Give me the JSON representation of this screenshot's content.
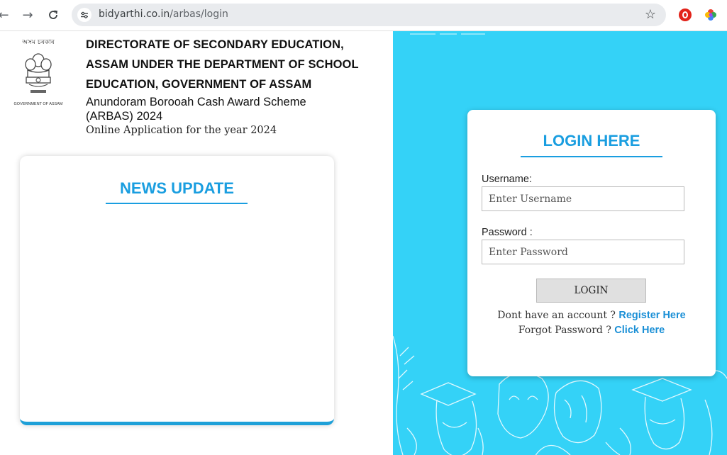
{
  "browser": {
    "url_host": "bidyarthi.co.in",
    "url_path": "/arbas/login",
    "icons": [
      "back-arrow-icon",
      "forward-arrow-icon",
      "reload-icon",
      "site-info-icon",
      "bookmark-star-icon",
      "opera-icon",
      "extension-icon"
    ]
  },
  "header": {
    "emblem_top": "অসম চৰকাৰ",
    "emblem_bottom": "GOVERNMENT OF ASSAM",
    "title_lines": [
      "DIRECTORATE OF SECONDARY EDUCATION,",
      "ASSAM UNDER THE DEPARTMENT OF SCHOOL",
      "EDUCATION, GOVERNMENT OF ASSAM"
    ],
    "scheme_lines": [
      "Anundoram Borooah Cash Award Scheme",
      "(ARBAS) 2024"
    ],
    "online": "Online Application for the year 2024"
  },
  "news": {
    "title": "NEWS UPDATE"
  },
  "login": {
    "title": "LOGIN HERE",
    "username_label": "Username:",
    "username_placeholder": "Enter Username",
    "password_label": "Password :",
    "password_placeholder": "Enter Password",
    "button": "LOGIN",
    "register_prompt": "Dont have an account ?",
    "register_link": "Register Here",
    "forgot_prompt": "Forgot Password ?",
    "forgot_link": "Click Here"
  },
  "colors": {
    "accent": "#1a9ee0",
    "right_bg": "#34d2f7",
    "link": "#1a8fd6"
  }
}
